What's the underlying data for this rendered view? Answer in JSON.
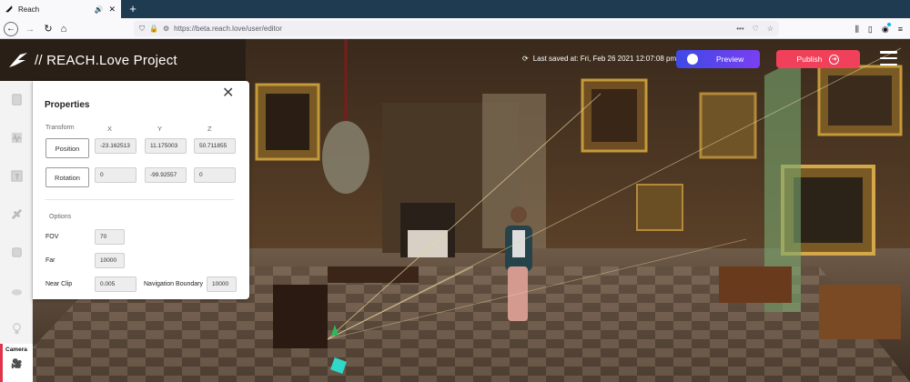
{
  "browser": {
    "tab_title": "Reach",
    "url": "https://beta.reach.love/user/editor"
  },
  "app": {
    "title": "// REACH.Love Project",
    "save_status": "Last saved at: Fri, Feb 26 2021 12:07:08 pm",
    "preview_label": "Preview",
    "publish_label": "Publish"
  },
  "properties": {
    "title": "Properties",
    "transform_label": "Transform",
    "axes": [
      "X",
      "Y",
      "Z"
    ],
    "position_label": "Position",
    "position": [
      "-23.162513",
      "11.175003",
      "50.711855"
    ],
    "rotation_label": "Rotation",
    "rotation": [
      "0",
      "-99.92557",
      "0"
    ],
    "options_label": "Options",
    "fov_label": "FOV",
    "fov": "70",
    "far_label": "Far",
    "far": "10000",
    "near_clip_label": "Near Clip",
    "near_clip": "0.005",
    "nav_boundary_label": "Navigation Boundary",
    "nav_boundary": "10000"
  },
  "toolbar": {
    "tools": [
      "image-tool",
      "audio-tool",
      "text-tool",
      "model-tool",
      "box-tool",
      "cloud-tool",
      "light-tool"
    ],
    "camera_label": "Camera"
  },
  "colors": {
    "preview_from": "#3e49e6",
    "preview_to": "#7a3ff2",
    "publish": "#f0405a",
    "camera_accent": "#e0334d"
  }
}
